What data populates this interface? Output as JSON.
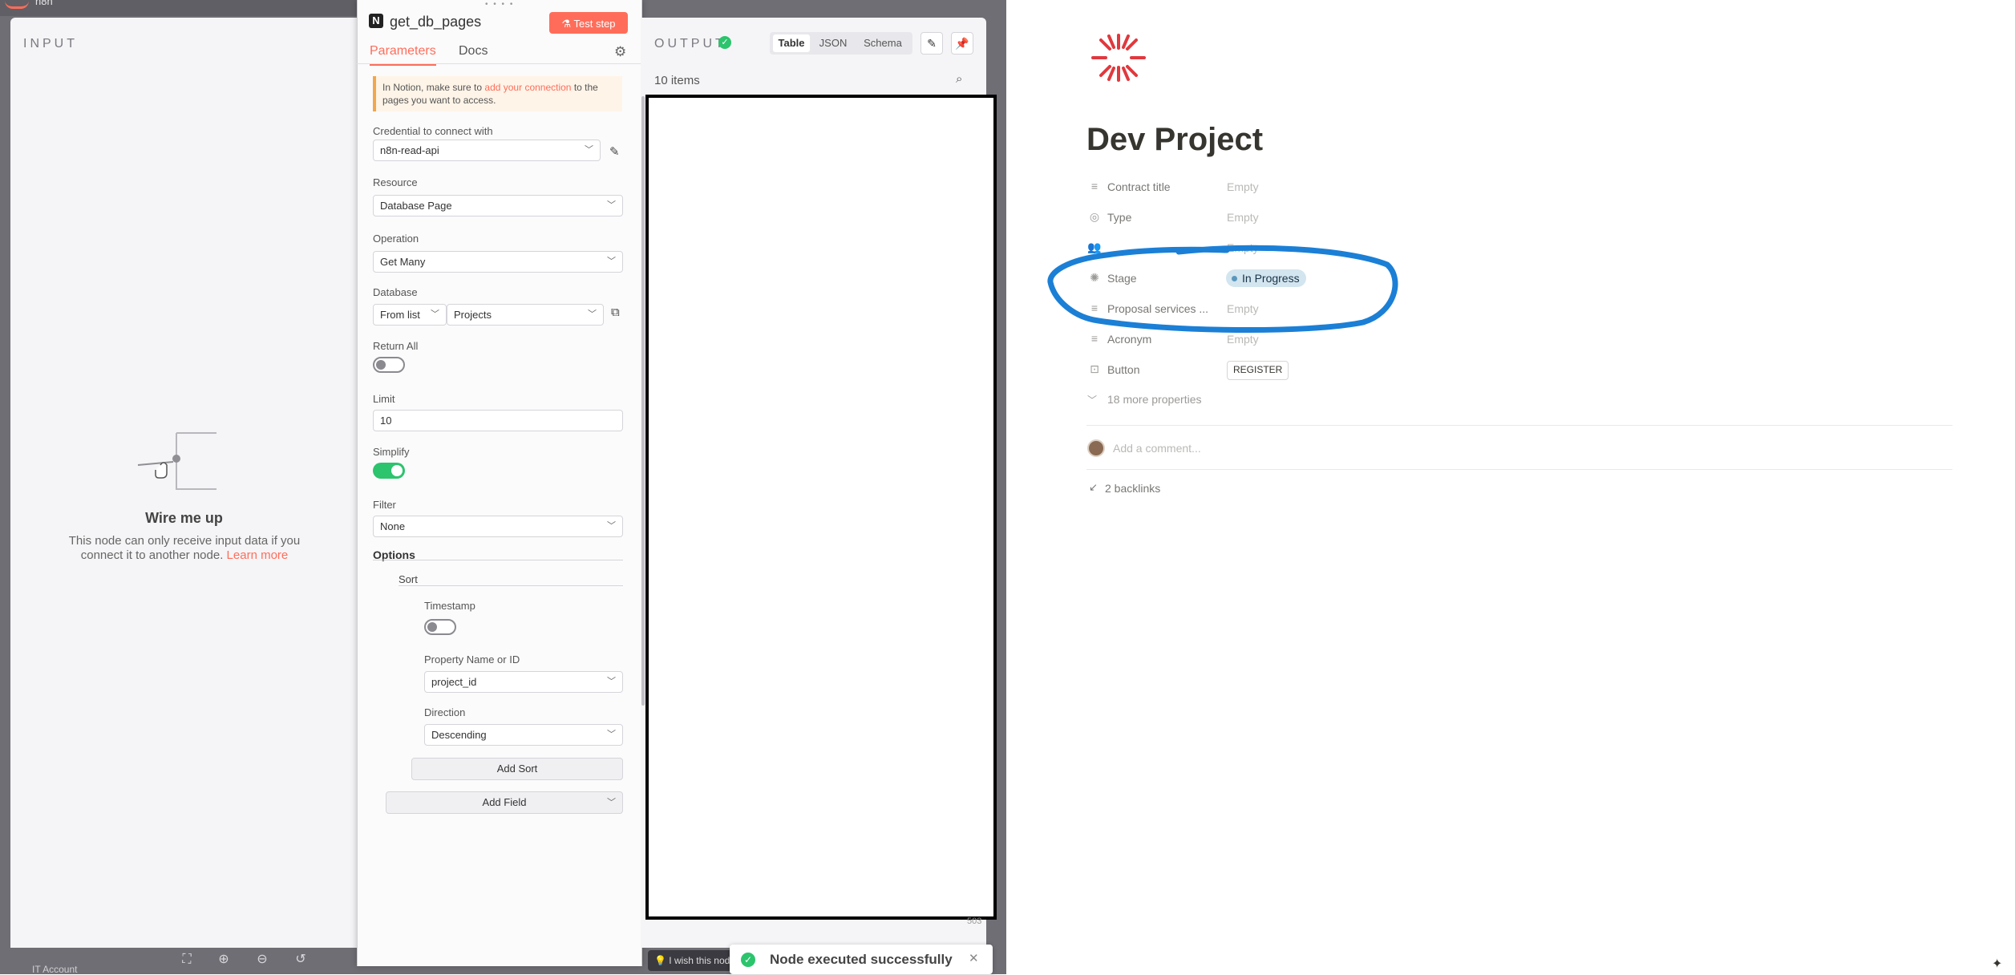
{
  "app": {
    "logo_text": "n8n"
  },
  "input_panel": {
    "label": "INPUT",
    "wire_title": "Wire me up",
    "wire_text": "This node can only receive input data if you connect it to another node.",
    "learn_more": "Learn more"
  },
  "bottom_bar": {
    "account": "IT Account"
  },
  "node": {
    "title": "get_db_pages",
    "test_step": "Test step",
    "tabs": {
      "parameters": "Parameters",
      "docs": "Docs"
    },
    "notice_prefix": "In Notion, make sure to ",
    "notice_link": "add your connection",
    "notice_suffix": " to the pages you want to access.",
    "credential_label": "Credential to connect with",
    "credential_value": "n8n-read-api",
    "resource_label": "Resource",
    "resource_value": "Database Page",
    "operation_label": "Operation",
    "operation_value": "Get Many",
    "database_label": "Database",
    "database_mode": "From list",
    "database_value": "Projects",
    "return_all_label": "Return All",
    "return_all": false,
    "limit_label": "Limit",
    "limit_value": "10",
    "simplify_label": "Simplify",
    "simplify": true,
    "filter_label": "Filter",
    "filter_value": "None",
    "options_label": "Options",
    "sort_label": "Sort",
    "timestamp_label": "Timestamp",
    "timestamp": false,
    "property_label": "Property Name or ID",
    "property_value": "project_id",
    "direction_label": "Direction",
    "direction_value": "Descending",
    "add_sort": "Add Sort",
    "add_field": "Add Field"
  },
  "output": {
    "label": "OUTPUT",
    "views": {
      "table": "Table",
      "json": "JSON",
      "schema": "Schema"
    },
    "items_count": "10 items",
    "scroll_num": "503"
  },
  "toasts": {
    "wish": "I wish this node",
    "success": "Node executed successfully"
  },
  "notion": {
    "title": "Dev Project",
    "properties": [
      {
        "name": "Contract title",
        "value": "Empty",
        "icon": "text-icon"
      },
      {
        "name": "Type",
        "value": "Empty",
        "icon": "select-icon"
      },
      {
        "name": "",
        "value": "Empty",
        "icon": "people-icon"
      },
      {
        "name": "Stage",
        "value": "In Progress",
        "icon": "status-icon"
      },
      {
        "name": "Proposal services ...",
        "value": "Empty",
        "icon": "text-icon"
      },
      {
        "name": "Acronym",
        "value": "Empty",
        "icon": "text-icon"
      },
      {
        "name": "Button",
        "value": "REGISTER",
        "icon": "button-icon"
      }
    ],
    "more_properties": "18 more properties",
    "comment_placeholder": "Add a comment...",
    "backlinks": "2 backlinks",
    "colors": {
      "accent_red": "#e0393e",
      "annotation_blue": "#1b7fd6",
      "status_tag_bg": "#d3e5ef"
    }
  }
}
